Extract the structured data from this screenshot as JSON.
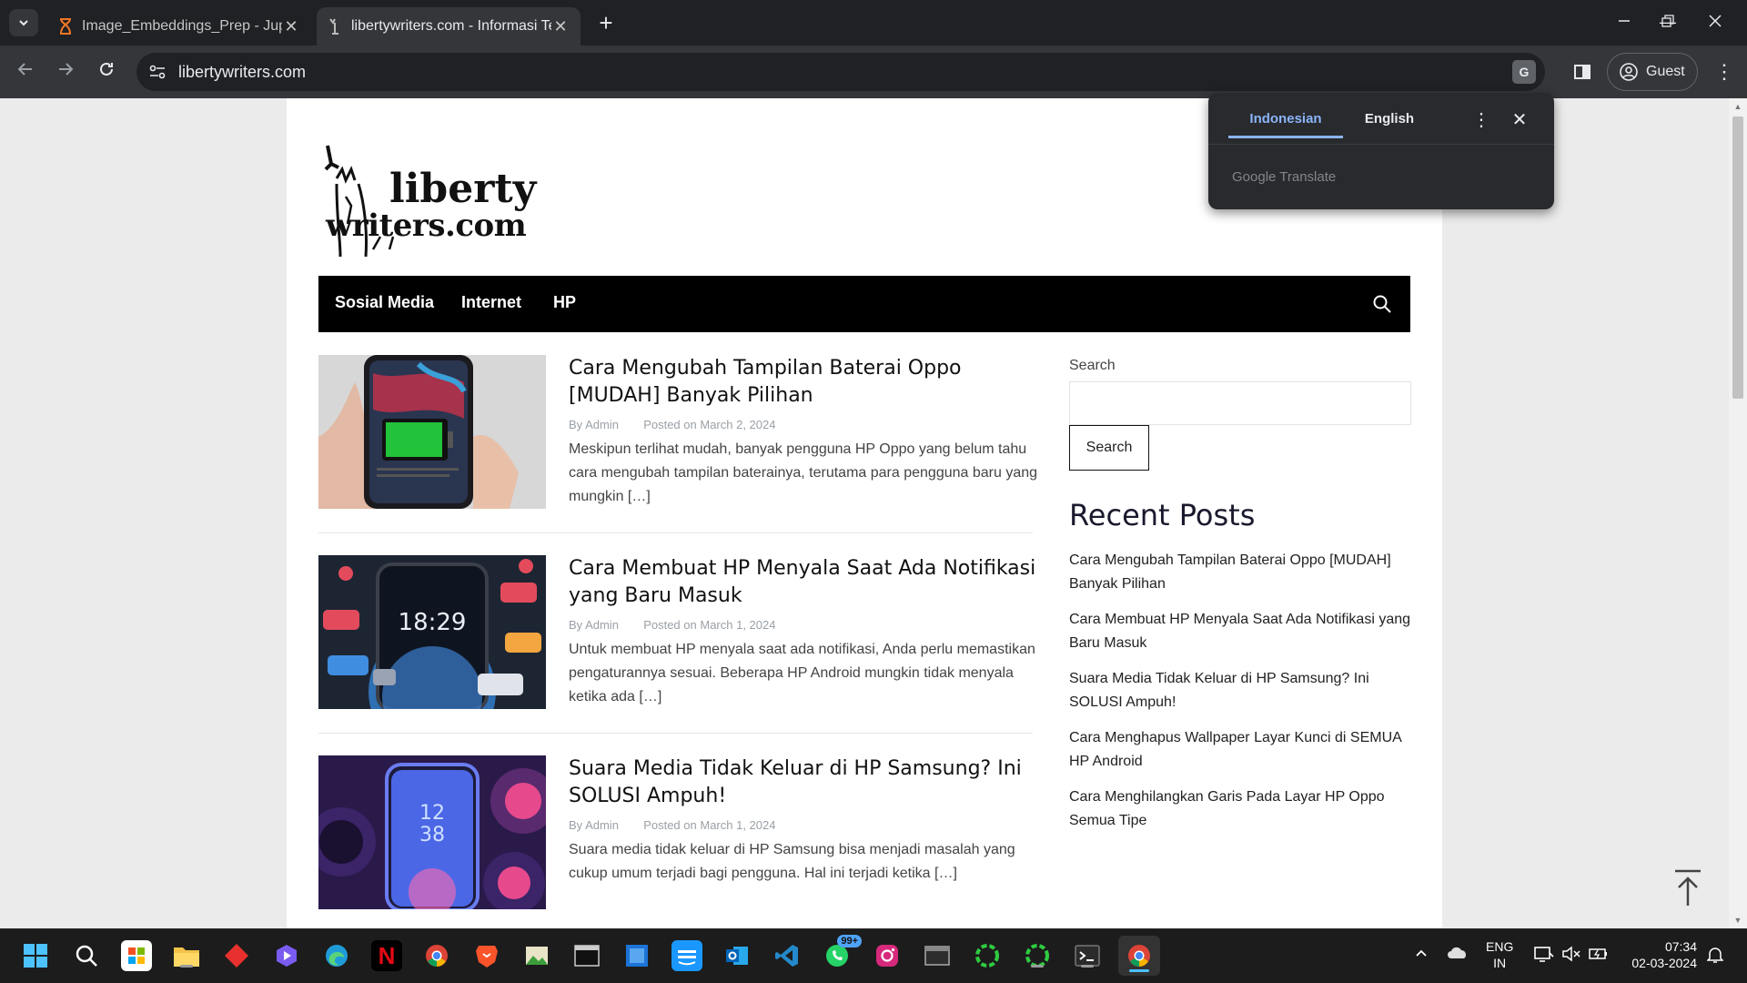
{
  "browser": {
    "tabs": [
      {
        "title": "Image_Embeddings_Prep - Jupy",
        "active": false
      },
      {
        "title": "libertywriters.com - Informasi Te",
        "active": true
      }
    ],
    "url": "libertywriters.com",
    "guest_label": "Guest"
  },
  "translate_popup": {
    "lang_source": "Indonesian",
    "lang_target": "English",
    "brand": "Google Translate"
  },
  "site": {
    "logo_line1": "liberty",
    "logo_line2": "writers.com",
    "nav": [
      "Sosial Media",
      "Internet",
      "HP"
    ],
    "posts": [
      {
        "title": "Cara Mengubah Tampilan Baterai Oppo [MUDAH] Banyak Pilihan",
        "by_label": "By",
        "author": "Admin",
        "posted_label": "Posted on",
        "date": "March 2, 2024",
        "excerpt": "Meskipun terlihat mudah, banyak pengguna HP Oppo yang belum tahu cara mengubah tampilan baterainya, terutama para pengguna baru yang mungkin […]"
      },
      {
        "title": "Cara Membuat HP Menyala Saat Ada Notifikasi yang Baru Masuk",
        "by_label": "By",
        "author": "Admin",
        "posted_label": "Posted on",
        "date": "March 1, 2024",
        "excerpt": "Untuk membuat HP menyala saat ada notifikasi, Anda perlu memastikan pengaturannya sesuai. Beberapa HP Android mungkin tidak menyala ketika ada […]"
      },
      {
        "title": "Suara Media Tidak Keluar di HP Samsung? Ini SOLUSI Ampuh!",
        "by_label": "By",
        "author": "Admin",
        "posted_label": "Posted on",
        "date": "March 1, 2024",
        "excerpt": "Suara media tidak keluar di HP Samsung bisa menjadi masalah yang cukup umum terjadi bagi pengguna. Hal ini terjadi ketika […]"
      }
    ],
    "thumb_texts": {
      "clock1": "18:29",
      "clock2_h": "12",
      "clock2_m": "38"
    },
    "sidebar": {
      "search_label": "Search",
      "search_button": "Search",
      "recent_heading": "Recent Posts",
      "recent_posts": [
        "Cara Mengubah Tampilan Baterai Oppo [MUDAH] Banyak Pilihan",
        "Cara Membuat HP Menyala Saat Ada Notifikasi yang Baru Masuk",
        "Suara Media Tidak Keluar di HP Samsung? Ini SOLUSI Ampuh!",
        "Cara Menghapus Wallpaper Layar Kunci di SEMUA HP Android",
        "Cara Menghilangkan Garis Pada Layar HP Oppo Semua Tipe"
      ]
    }
  },
  "taskbar": {
    "badge_count": "99+",
    "lang_line1": "ENG",
    "lang_line2": "IN",
    "time": "07:34",
    "date": "02-03-2024"
  },
  "colors": {
    "chrome_dark": "#202124",
    "chrome_toolbar": "#35363a",
    "nav_bar": "#000000",
    "accent_blue": "#8ab4f8"
  }
}
